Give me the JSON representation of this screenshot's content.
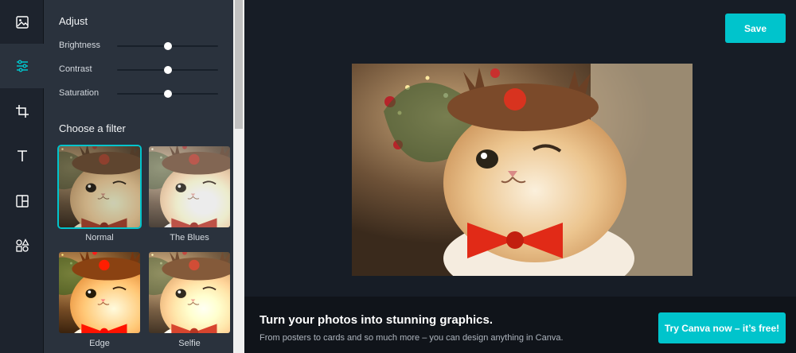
{
  "rail": {
    "items": [
      {
        "id": "photos",
        "icon": "image-icon"
      },
      {
        "id": "adjust",
        "icon": "sliders-icon",
        "active": true
      },
      {
        "id": "crop",
        "icon": "crop-icon"
      },
      {
        "id": "text",
        "icon": "text-icon"
      },
      {
        "id": "layout",
        "icon": "layout-icon"
      },
      {
        "id": "elements",
        "icon": "shapes-icon"
      }
    ]
  },
  "adjust": {
    "heading": "Adjust",
    "sliders": [
      {
        "label": "Brightness",
        "value": 0.5
      },
      {
        "label": "Contrast",
        "value": 0.5
      },
      {
        "label": "Saturation",
        "value": 0.5
      }
    ]
  },
  "filters": {
    "heading": "Choose a filter",
    "items": [
      {
        "label": "Normal",
        "selected": true
      },
      {
        "label": "The Blues"
      },
      {
        "label": "Edge"
      },
      {
        "label": "Selfie"
      }
    ]
  },
  "canvas": {
    "save_label": "Save"
  },
  "promo": {
    "title": "Turn your photos into stunning graphics.",
    "subtitle": "From posters to cards and so much more – you can design anything in Canva.",
    "cta_label": "Try Canva now – it’s free!"
  },
  "colors": {
    "accent": "#00c4cc",
    "rail": "#1d232d",
    "panel": "#2a323d",
    "canvas": "#171d26"
  }
}
